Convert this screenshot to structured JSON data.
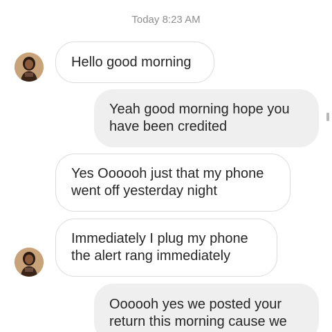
{
  "header": {
    "timestamp": "Today 8:23 AM"
  },
  "messages": [
    {
      "direction": "received",
      "text": "Hello good morning",
      "show_avatar": true
    },
    {
      "direction": "sent",
      "text": "Yeah good morning hope you have been credited"
    },
    {
      "direction": "received",
      "text": "Yes Oooooh just that my phone went off yesterday night",
      "show_avatar": false
    },
    {
      "direction": "received",
      "text": "Immediately I plug my phone the alert rang immediately",
      "show_avatar": true
    },
    {
      "direction": "sent",
      "text": "Oooooh yes we posted your return this morning cause we"
    }
  ],
  "colors": {
    "received_bubble_bg": "#ffffff",
    "received_bubble_border": "#dbdbdb",
    "sent_bubble_bg": "#efefef",
    "text": "#262626",
    "timestamp": "#8e8e8e"
  },
  "icons": {
    "avatar": "profile-photo-avatar",
    "status": "message-status-icon"
  }
}
